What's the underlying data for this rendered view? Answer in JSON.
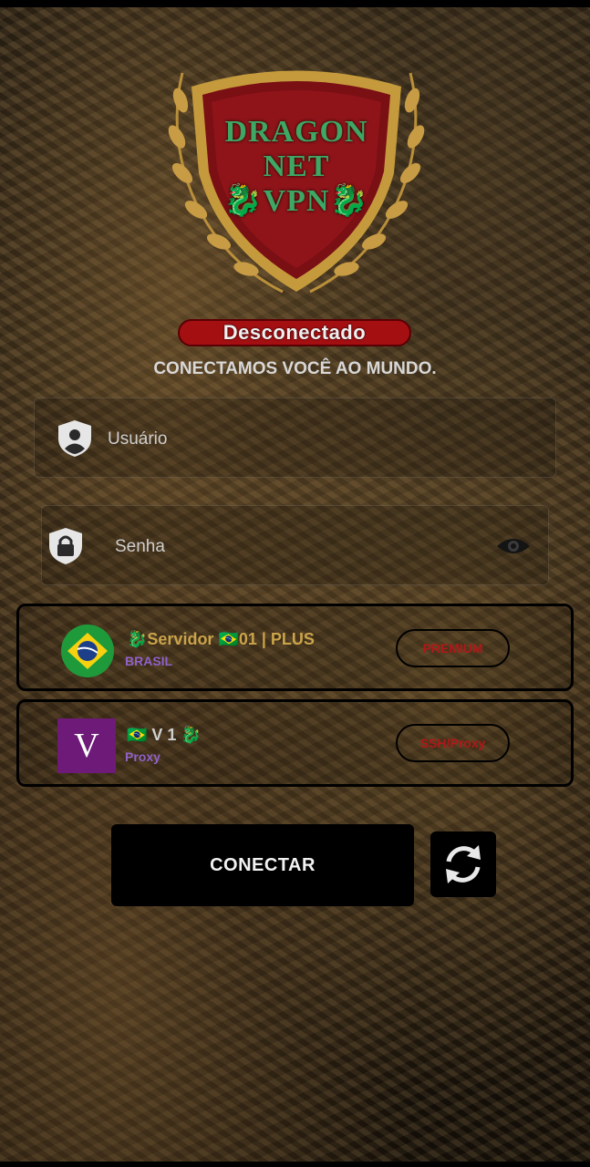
{
  "logo": {
    "line1": "DRAGON",
    "line2": "NET",
    "line3": "🐉VPN🐉"
  },
  "status": {
    "label": "Desconectado"
  },
  "tagline": "CONECTAMOS VOCÊ AO MUNDO.",
  "form": {
    "username_placeholder": "Usuário",
    "password_placeholder": "Senha"
  },
  "server": {
    "title": "🐉Servidor 🇧🇷01 | PLUS",
    "subtitle": "BRASIL",
    "badge": "PREMIUM"
  },
  "connection": {
    "tile_letter": "V",
    "title": "🇧🇷 V 1 🐉",
    "subtitle": "Proxy",
    "badge": "SSH/Proxy"
  },
  "actions": {
    "connect_label": "CONECTAR"
  },
  "icons": {
    "user": "user-shield-icon",
    "lock": "lock-shield-icon",
    "eye": "eye-icon",
    "refresh": "refresh-icon",
    "flag": "brazil-flag-icon"
  },
  "colors": {
    "status_red": "#a40f12",
    "logo_green": "#3ea763",
    "server_gold": "#caa34a",
    "subtitle_purple": "#8f62c9",
    "badge_red": "#b01818",
    "tile_purple": "#6d1a78"
  }
}
